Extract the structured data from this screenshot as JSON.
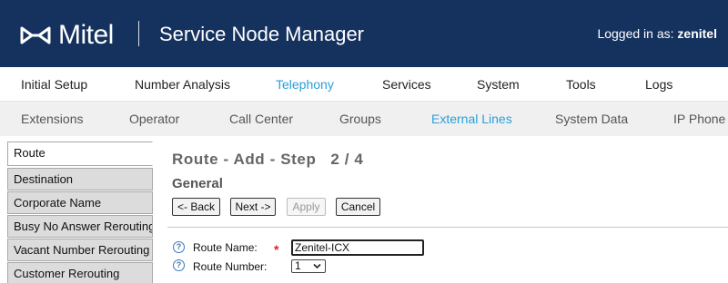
{
  "header": {
    "brand": "Mitel",
    "app_title": "Service Node Manager",
    "login_prefix": "Logged in as:",
    "username": "zenitel"
  },
  "nav_primary": [
    "Initial Setup",
    "Number Analysis",
    "Telephony",
    "Services",
    "System",
    "Tools",
    "Logs"
  ],
  "nav_primary_active": "Telephony",
  "nav_secondary": [
    "Extensions",
    "Operator",
    "Call Center",
    "Groups",
    "External Lines",
    "System Data",
    "IP Phone"
  ],
  "nav_secondary_active": "External Lines",
  "side_tabs": [
    "Route",
    "Destination",
    "Corporate Name",
    "Busy No Answer Rerouting",
    "Vacant Number Rerouting",
    "Customer Rerouting"
  ],
  "side_tabs_active": "Route",
  "main": {
    "title": "Route - Add - Step   2 / 4",
    "section": "General",
    "buttons": {
      "back": "<- Back",
      "next": "Next ->",
      "apply": "Apply",
      "cancel": "Cancel"
    },
    "fields": {
      "route_name_label": "Route Name:",
      "route_name_value": "Zenitel-ICX",
      "required_marker": "*",
      "route_number_label": "Route Number:",
      "route_number_value": "1"
    }
  },
  "colors": {
    "header_bg": "#15325f",
    "accent_active": "#2a9fd8"
  },
  "icons": [
    "mitel-logo-icon",
    "help-icon",
    "chevron-down-icon"
  ]
}
